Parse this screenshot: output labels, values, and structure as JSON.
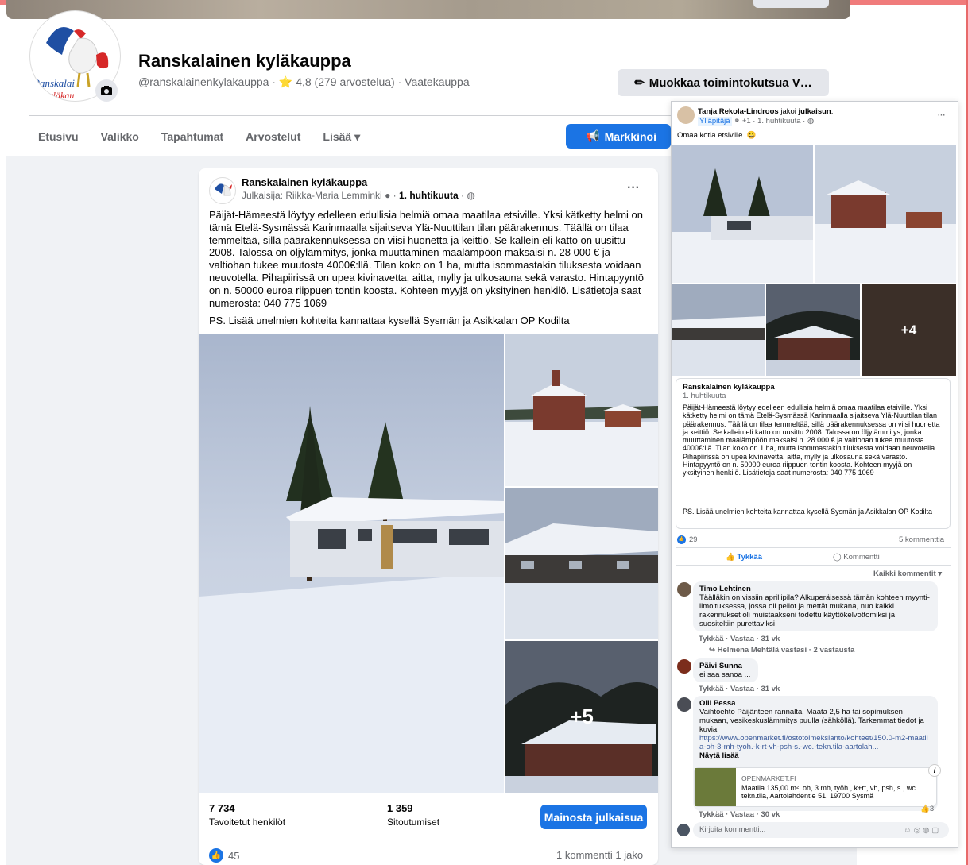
{
  "page": {
    "name": "Ranskalainen kyläkauppa",
    "meta": "@ranskalainenkylakauppa · ⭐ 4,8 (279 arvostelua) · Vaatekauppa",
    "edit_cta": "Muokkaa toimintokutsua V…",
    "logo_text": "Ranskalainen kyläkauppa"
  },
  "tabs": [
    "Etusivu",
    "Valikko",
    "Tapahtumat",
    "Arvostelut",
    "Lisää ▾"
  ],
  "markkinoi": "Markkinoi",
  "post": {
    "author": "Ranskalainen kyläkauppa",
    "sub": "Julkaisija: Riikka-Maria Lemminki",
    "date": "1. huhtikuuta",
    "more": "···",
    "body": "Päijät-Hämeestä löytyy edelleen edullisia helmiä omaa maatilaa etsiville. Yksi kätketty helmi on tämä Etelä-Sysmässä Karinmaalla sijaitseva Ylä-Nuuttilan tilan päärakennus. Täällä on tilaa temmeltää, sillä päärakennuksessa on viisi huonetta ja keittiö. Se kallein eli katto on uusittu 2008. Talossa on öljylämmitys, jonka muuttaminen maalämpöön maksaisi n. 28 000 € ja valtiohan tukee muutosta 4000€:llä. Tilan koko on 1 ha, mutta isommastakin tiluksesta voidaan neuvotella. Pihapiirissä on upea kivinavetta, aitta, mylly ja ulkosauna sekä varasto. Hintapyyntö on n. 50000 euroa riippuen tontin koosta. Kohteen myyjä on yksityinen henkilö. Lisätietoja saat numerosta: 040 775 1069",
    "ps": "PS. Lisää unelmien kohteita kannattaa kysellä Sysmän ja Asikkalan OP Kodilta",
    "more_photos": "+5",
    "reach_value": "7 734",
    "reach_label": "Tavoitetut henkilöt",
    "engage_value": "1 359",
    "engage_label": "Sitoutumiset",
    "promote": "Mainosta julkaisua",
    "likes": "45",
    "comments_shares": "1 kommentti  1 jako"
  },
  "share": {
    "sharer": "Tanja Rekola-Lindroos",
    "action": "jakoi",
    "object": "julkaisun",
    "badge": "Ylläpitäjä",
    "badge_extra": "+1",
    "date": "1. huhtikuuta",
    "more": "···",
    "text": "Omaa kotia etsiville. 😀",
    "more_photos": "+4",
    "orig_name": "Ranskalainen kyläkauppa",
    "orig_date": "1. huhtikuuta",
    "orig_body": "Päijät-Hämeestä löytyy edelleen edullisia helmiä omaa maatilaa etsiville. Yksi kätketty helmi on tämä Etelä-Sysmässä Karinmaalla sijaitseva Ylä-Nuuttilan tilan päärakennus. Täällä on tilaa temmeltää, sillä päärakennuksessa on viisi huonetta ja keittiö. Se kallein eli katto on uusittu 2008. Talossa on öljylämmitys, jonka muuttaminen maalämpöön maksaisi n. 28 000 € ja valtiohan tukee muutosta 4000€:llä. Tilan koko on 1 ha, mutta isommastakin tiluksesta voidaan neuvotella. Pihapiirissä on upea kivinavetta, aitta, mylly ja ulkosauna sekä varasto. Hintapyyntö on n. 50000 euroa riippuen tontin koosta. Kohteen myyjä on yksityinen henkilö. Lisätietoja saat numerosta: 040 775 1069",
    "orig_ps": "PS. Lisää unelmien kohteita kannattaa kysellä Sysmän ja Asikkalan OP Kodilta",
    "likes": "29",
    "comments": "5 kommenttia",
    "like_btn": "Tykkää",
    "comment_btn": "Kommentti",
    "filter": "Kaikki kommentit ▾",
    "comment_list": [
      {
        "name": "Timo Lehtinen",
        "text": "Täälläkin on vissiin aprillipila? Alkuperäisessä tämän kohteen myynti-ilmoituksessa, jossa oli pellot ja mettät mukana, nuo kaikki rakennukset oli muistaakseni todettu käyttökelvottomiksi ja suositeltiin purettaviksi",
        "actions": "Tykkää · Vastaa · 31 vk",
        "reply": "Helmena Mehtälä vastasi · 2 vastausta"
      },
      {
        "name": "Päivi Sunna",
        "text": "ei saa sanoa ...",
        "actions": "Tykkää · Vastaa · 31 vk"
      },
      {
        "name": "Olli Pessa",
        "text": "Vaihtoehto Päijänteen rannalta. Maata 2,5 ha tai sopimuksen mukaan, vesikeskuslämmitys puulla (sähköllä). Tarkemmat tiedot ja kuvia:",
        "link": "https://www.openmarket.fi/ostotoimeksianto/kohteet/150.0-m2-maatila-oh-3-mh-tyoh.-k-rt-vh-psh-s.-wc.-tekn.tila-aartolah...",
        "see_more": "Näytä lisää",
        "preview_site": "OPENMARKET.FI",
        "preview_title": "Maatila 135,00 m², oh, 3 mh, työh., k+rt, vh, psh, s., wc. tekn.tila, Aartolahdentie 51, 19700 Sysmä",
        "preview_likes": "3",
        "actions": "Tykkää · Vastaa · 30 vk"
      }
    ],
    "input_placeholder": "Kirjoita kommentti..."
  },
  "colors": {
    "accent": "#1b74e4",
    "bg": "#f0f2f5"
  }
}
